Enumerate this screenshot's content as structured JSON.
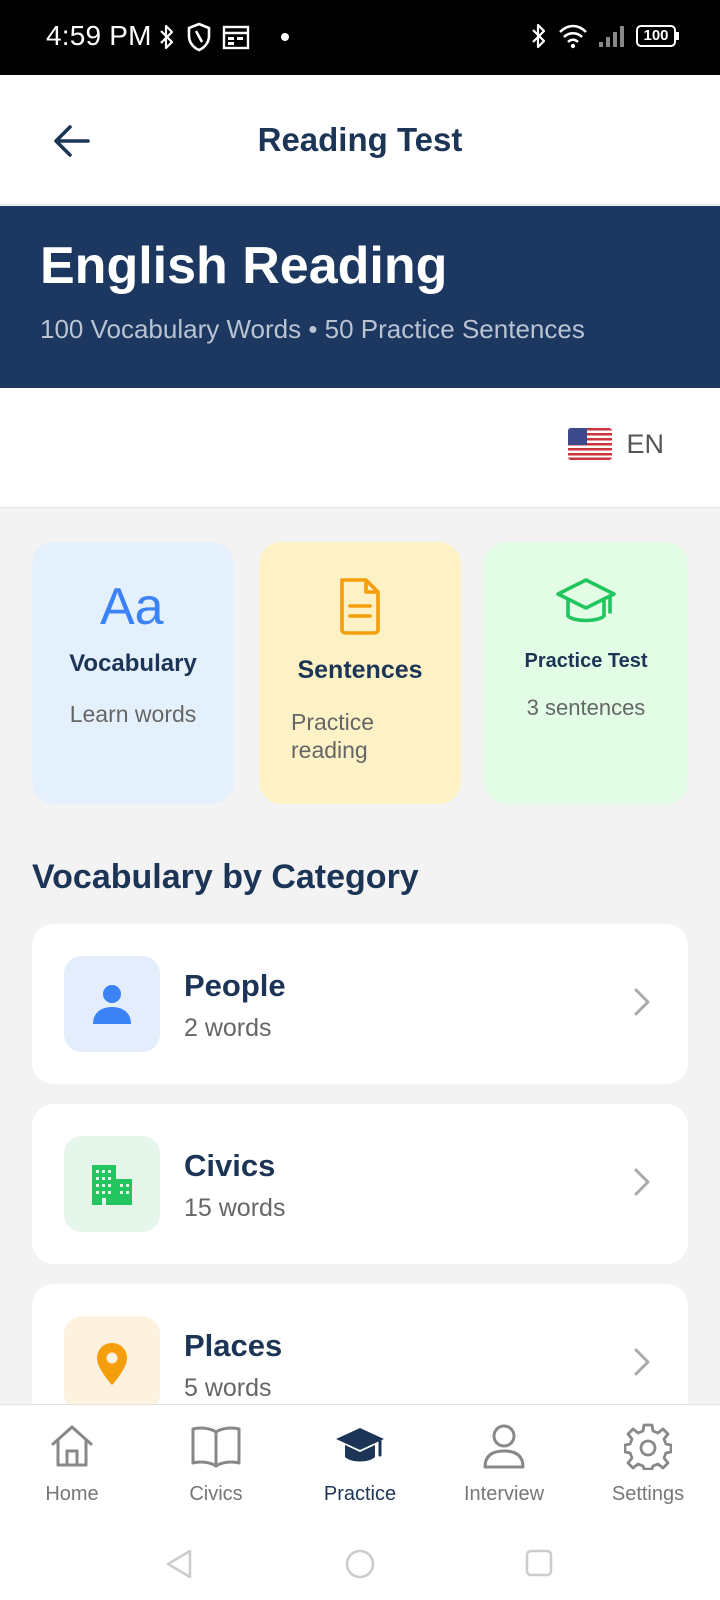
{
  "status_bar": {
    "time": "4:59 PM",
    "battery": "100"
  },
  "app_bar": {
    "title": "Reading Test"
  },
  "hero": {
    "title": "English Reading",
    "subtitle": "100 Vocabulary Words • 50 Practice Sentences"
  },
  "language": {
    "code": "EN"
  },
  "modes": [
    {
      "title": "Vocabulary",
      "subtitle": "Learn words",
      "icon": "text-aa-icon",
      "color": "#3b82f6"
    },
    {
      "title": "Sentences",
      "subtitle": "Practice reading",
      "icon": "document-icon",
      "color": "#f59e0b"
    },
    {
      "title": "Practice Test",
      "subtitle": "3 sentences",
      "icon": "graduation-cap-icon",
      "color": "#22c55e"
    }
  ],
  "section_title": "Vocabulary by Category",
  "categories": [
    {
      "name": "People",
      "count": "2 words",
      "icon": "person-icon",
      "color": "#3b82f6"
    },
    {
      "name": "Civics",
      "count": "15 words",
      "icon": "buildings-icon",
      "color": "#22c55e"
    },
    {
      "name": "Places",
      "count": "5 words",
      "icon": "location-pin-icon",
      "color": "#f59e0b"
    }
  ],
  "bottom_nav": [
    {
      "label": "Home",
      "icon": "home-icon"
    },
    {
      "label": "Civics",
      "icon": "book-icon"
    },
    {
      "label": "Practice",
      "icon": "graduation-cap-icon",
      "active": true
    },
    {
      "label": "Interview",
      "icon": "person-outline-icon"
    },
    {
      "label": "Settings",
      "icon": "gear-icon"
    }
  ],
  "colors": {
    "brand_navy": "#1c3760",
    "vocab_bg": "#e5f0fd",
    "sentences_bg": "#fdf2c6",
    "test_bg": "#e2fce6"
  }
}
